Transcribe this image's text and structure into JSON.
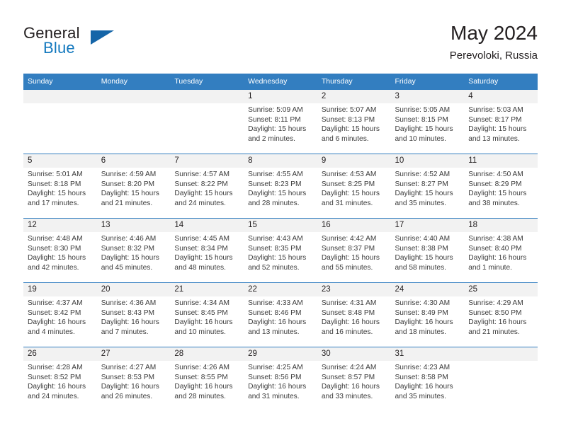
{
  "brand": {
    "name_part1": "General",
    "name_part2": "Blue",
    "triangle_color": "#1565a8",
    "blue_color": "#1278be"
  },
  "header": {
    "title": "May 2024",
    "subtitle": "Perevoloki, Russia"
  },
  "theme": {
    "header_bg": "#337ec0",
    "header_text": "#ffffff",
    "daynum_band_bg": "#f2f2f2",
    "row_rule": "#337ec0",
    "body_text": "#3b3b3b"
  },
  "weekday_headers": [
    "Sunday",
    "Monday",
    "Tuesday",
    "Wednesday",
    "Thursday",
    "Friday",
    "Saturday"
  ],
  "weeks": [
    [
      {
        "day": "",
        "sunrise": "",
        "sunset": "",
        "daylight_line1": "",
        "daylight_line2": ""
      },
      {
        "day": "",
        "sunrise": "",
        "sunset": "",
        "daylight_line1": "",
        "daylight_line2": ""
      },
      {
        "day": "",
        "sunrise": "",
        "sunset": "",
        "daylight_line1": "",
        "daylight_line2": ""
      },
      {
        "day": "1",
        "sunrise": "Sunrise: 5:09 AM",
        "sunset": "Sunset: 8:11 PM",
        "daylight_line1": "Daylight: 15 hours",
        "daylight_line2": "and 2 minutes."
      },
      {
        "day": "2",
        "sunrise": "Sunrise: 5:07 AM",
        "sunset": "Sunset: 8:13 PM",
        "daylight_line1": "Daylight: 15 hours",
        "daylight_line2": "and 6 minutes."
      },
      {
        "day": "3",
        "sunrise": "Sunrise: 5:05 AM",
        "sunset": "Sunset: 8:15 PM",
        "daylight_line1": "Daylight: 15 hours",
        "daylight_line2": "and 10 minutes."
      },
      {
        "day": "4",
        "sunrise": "Sunrise: 5:03 AM",
        "sunset": "Sunset: 8:17 PM",
        "daylight_line1": "Daylight: 15 hours",
        "daylight_line2": "and 13 minutes."
      }
    ],
    [
      {
        "day": "5",
        "sunrise": "Sunrise: 5:01 AM",
        "sunset": "Sunset: 8:18 PM",
        "daylight_line1": "Daylight: 15 hours",
        "daylight_line2": "and 17 minutes."
      },
      {
        "day": "6",
        "sunrise": "Sunrise: 4:59 AM",
        "sunset": "Sunset: 8:20 PM",
        "daylight_line1": "Daylight: 15 hours",
        "daylight_line2": "and 21 minutes."
      },
      {
        "day": "7",
        "sunrise": "Sunrise: 4:57 AM",
        "sunset": "Sunset: 8:22 PM",
        "daylight_line1": "Daylight: 15 hours",
        "daylight_line2": "and 24 minutes."
      },
      {
        "day": "8",
        "sunrise": "Sunrise: 4:55 AM",
        "sunset": "Sunset: 8:23 PM",
        "daylight_line1": "Daylight: 15 hours",
        "daylight_line2": "and 28 minutes."
      },
      {
        "day": "9",
        "sunrise": "Sunrise: 4:53 AM",
        "sunset": "Sunset: 8:25 PM",
        "daylight_line1": "Daylight: 15 hours",
        "daylight_line2": "and 31 minutes."
      },
      {
        "day": "10",
        "sunrise": "Sunrise: 4:52 AM",
        "sunset": "Sunset: 8:27 PM",
        "daylight_line1": "Daylight: 15 hours",
        "daylight_line2": "and 35 minutes."
      },
      {
        "day": "11",
        "sunrise": "Sunrise: 4:50 AM",
        "sunset": "Sunset: 8:29 PM",
        "daylight_line1": "Daylight: 15 hours",
        "daylight_line2": "and 38 minutes."
      }
    ],
    [
      {
        "day": "12",
        "sunrise": "Sunrise: 4:48 AM",
        "sunset": "Sunset: 8:30 PM",
        "daylight_line1": "Daylight: 15 hours",
        "daylight_line2": "and 42 minutes."
      },
      {
        "day": "13",
        "sunrise": "Sunrise: 4:46 AM",
        "sunset": "Sunset: 8:32 PM",
        "daylight_line1": "Daylight: 15 hours",
        "daylight_line2": "and 45 minutes."
      },
      {
        "day": "14",
        "sunrise": "Sunrise: 4:45 AM",
        "sunset": "Sunset: 8:34 PM",
        "daylight_line1": "Daylight: 15 hours",
        "daylight_line2": "and 48 minutes."
      },
      {
        "day": "15",
        "sunrise": "Sunrise: 4:43 AM",
        "sunset": "Sunset: 8:35 PM",
        "daylight_line1": "Daylight: 15 hours",
        "daylight_line2": "and 52 minutes."
      },
      {
        "day": "16",
        "sunrise": "Sunrise: 4:42 AM",
        "sunset": "Sunset: 8:37 PM",
        "daylight_line1": "Daylight: 15 hours",
        "daylight_line2": "and 55 minutes."
      },
      {
        "day": "17",
        "sunrise": "Sunrise: 4:40 AM",
        "sunset": "Sunset: 8:38 PM",
        "daylight_line1": "Daylight: 15 hours",
        "daylight_line2": "and 58 minutes."
      },
      {
        "day": "18",
        "sunrise": "Sunrise: 4:38 AM",
        "sunset": "Sunset: 8:40 PM",
        "daylight_line1": "Daylight: 16 hours",
        "daylight_line2": "and 1 minute."
      }
    ],
    [
      {
        "day": "19",
        "sunrise": "Sunrise: 4:37 AM",
        "sunset": "Sunset: 8:42 PM",
        "daylight_line1": "Daylight: 16 hours",
        "daylight_line2": "and 4 minutes."
      },
      {
        "day": "20",
        "sunrise": "Sunrise: 4:36 AM",
        "sunset": "Sunset: 8:43 PM",
        "daylight_line1": "Daylight: 16 hours",
        "daylight_line2": "and 7 minutes."
      },
      {
        "day": "21",
        "sunrise": "Sunrise: 4:34 AM",
        "sunset": "Sunset: 8:45 PM",
        "daylight_line1": "Daylight: 16 hours",
        "daylight_line2": "and 10 minutes."
      },
      {
        "day": "22",
        "sunrise": "Sunrise: 4:33 AM",
        "sunset": "Sunset: 8:46 PM",
        "daylight_line1": "Daylight: 16 hours",
        "daylight_line2": "and 13 minutes."
      },
      {
        "day": "23",
        "sunrise": "Sunrise: 4:31 AM",
        "sunset": "Sunset: 8:48 PM",
        "daylight_line1": "Daylight: 16 hours",
        "daylight_line2": "and 16 minutes."
      },
      {
        "day": "24",
        "sunrise": "Sunrise: 4:30 AM",
        "sunset": "Sunset: 8:49 PM",
        "daylight_line1": "Daylight: 16 hours",
        "daylight_line2": "and 18 minutes."
      },
      {
        "day": "25",
        "sunrise": "Sunrise: 4:29 AM",
        "sunset": "Sunset: 8:50 PM",
        "daylight_line1": "Daylight: 16 hours",
        "daylight_line2": "and 21 minutes."
      }
    ],
    [
      {
        "day": "26",
        "sunrise": "Sunrise: 4:28 AM",
        "sunset": "Sunset: 8:52 PM",
        "daylight_line1": "Daylight: 16 hours",
        "daylight_line2": "and 24 minutes."
      },
      {
        "day": "27",
        "sunrise": "Sunrise: 4:27 AM",
        "sunset": "Sunset: 8:53 PM",
        "daylight_line1": "Daylight: 16 hours",
        "daylight_line2": "and 26 minutes."
      },
      {
        "day": "28",
        "sunrise": "Sunrise: 4:26 AM",
        "sunset": "Sunset: 8:55 PM",
        "daylight_line1": "Daylight: 16 hours",
        "daylight_line2": "and 28 minutes."
      },
      {
        "day": "29",
        "sunrise": "Sunrise: 4:25 AM",
        "sunset": "Sunset: 8:56 PM",
        "daylight_line1": "Daylight: 16 hours",
        "daylight_line2": "and 31 minutes."
      },
      {
        "day": "30",
        "sunrise": "Sunrise: 4:24 AM",
        "sunset": "Sunset: 8:57 PM",
        "daylight_line1": "Daylight: 16 hours",
        "daylight_line2": "and 33 minutes."
      },
      {
        "day": "31",
        "sunrise": "Sunrise: 4:23 AM",
        "sunset": "Sunset: 8:58 PM",
        "daylight_line1": "Daylight: 16 hours",
        "daylight_line2": "and 35 minutes."
      },
      {
        "day": "",
        "sunrise": "",
        "sunset": "",
        "daylight_line1": "",
        "daylight_line2": ""
      }
    ]
  ]
}
